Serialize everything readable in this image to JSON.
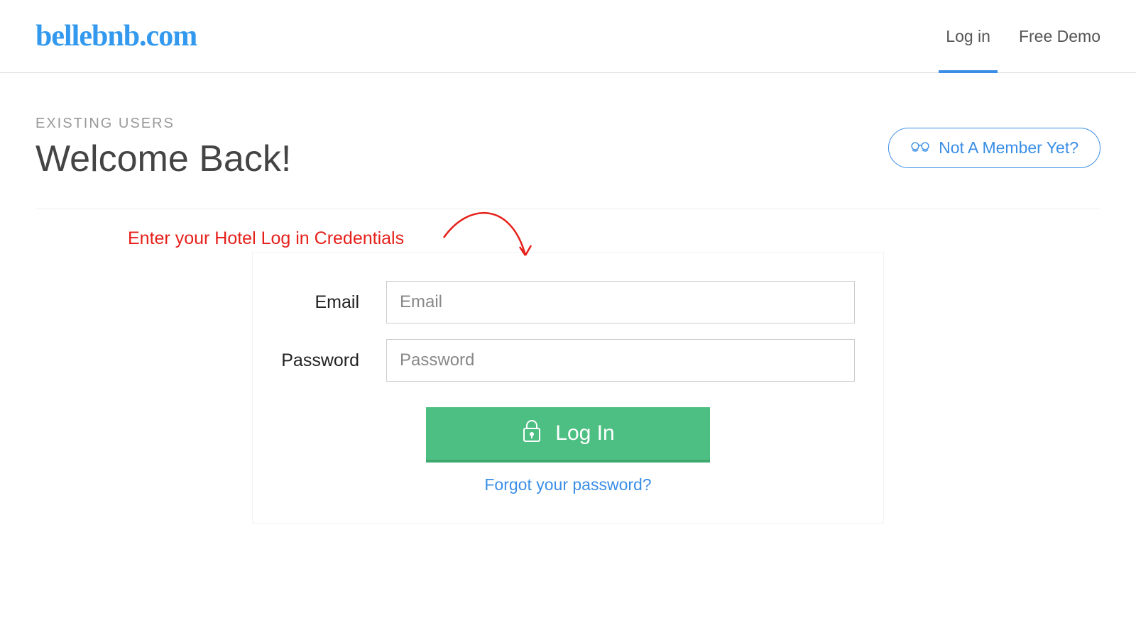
{
  "brand": "bellebnb.com",
  "nav": {
    "login": "Log in",
    "free_demo": "Free Demo"
  },
  "header": {
    "eyebrow": "EXISTING USERS",
    "title": "Welcome Back!",
    "not_member": "Not A Member Yet?"
  },
  "annotation": "Enter your Hotel Log in Credentials",
  "form": {
    "email_label": "Email",
    "email_placeholder": "Email",
    "email_value": "",
    "password_label": "Password",
    "password_placeholder": "Password",
    "password_value": "",
    "login_button": "Log In",
    "forgot": "Forgot your password?"
  },
  "colors": {
    "brand_blue": "#3a8ee6",
    "action_green": "#4dbf82",
    "annotation_red": "#e6201a"
  }
}
